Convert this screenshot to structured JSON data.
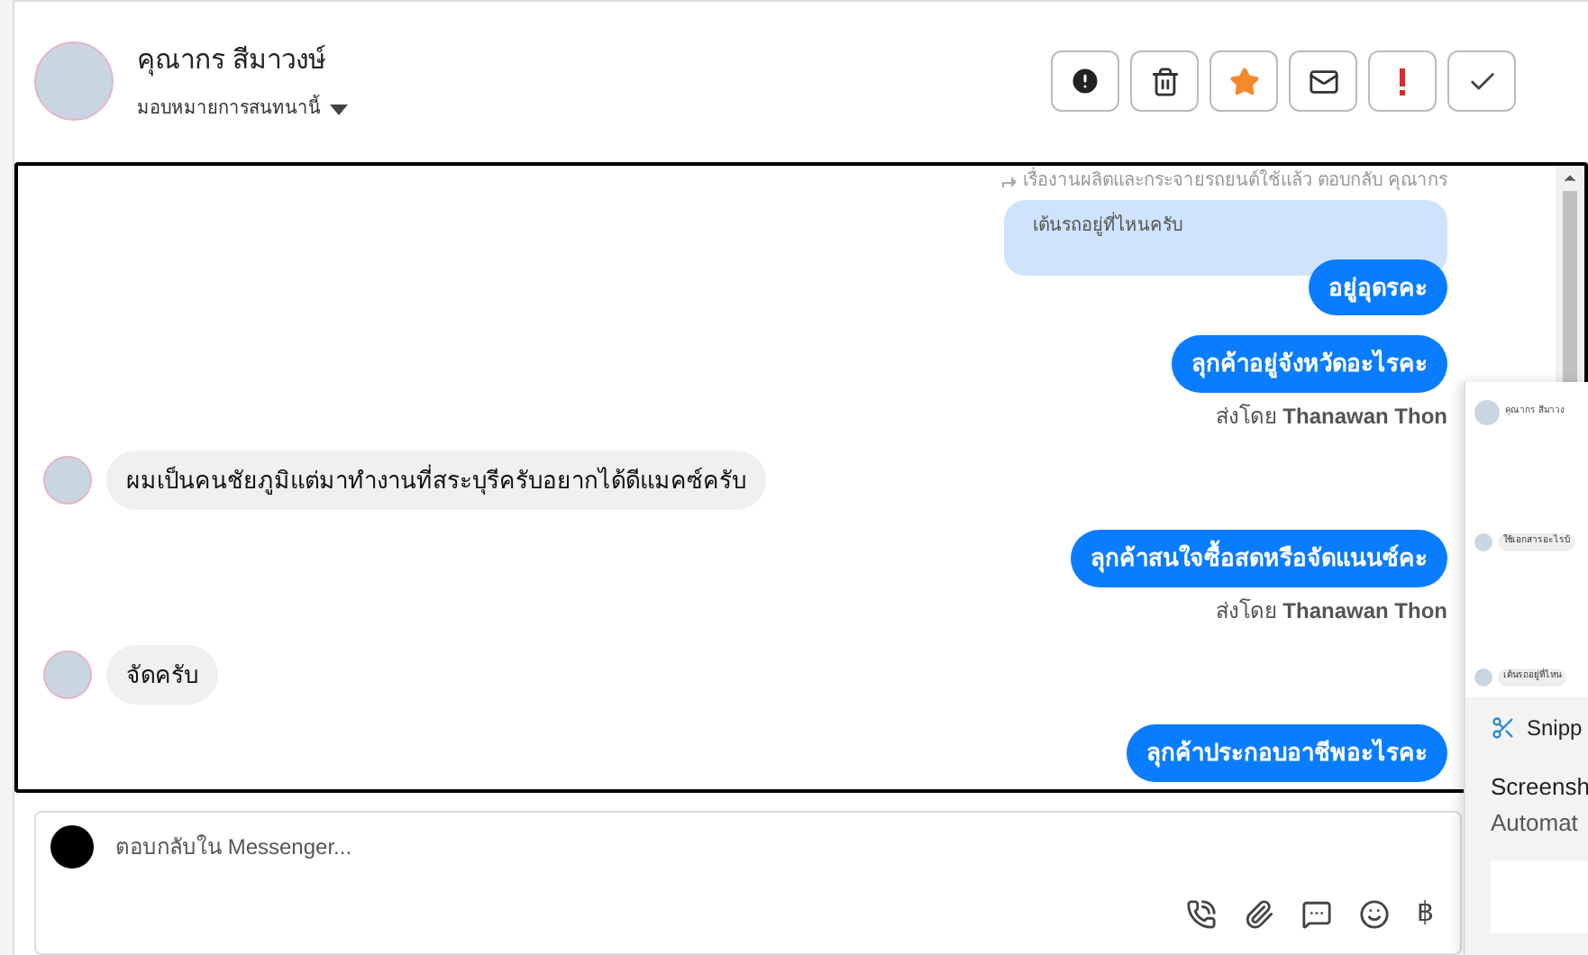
{
  "header": {
    "name": "คุณากร สีมาวงษ์",
    "assign": "มอบหมายการสนทนานี้",
    "actions": [
      {
        "kind": "alert"
      },
      {
        "kind": "trash"
      },
      {
        "kind": "star"
      },
      {
        "kind": "mail"
      },
      {
        "kind": "important"
      },
      {
        "kind": "done"
      }
    ]
  },
  "messages": [
    {
      "kind": "quote",
      "text": "เรื่องานผลิตและกระจายรถยนต์ใช้แล้ว ตอบกลับ คุณากร",
      "quoted": "เต้นรถอยู่ที่ไหนครับ"
    },
    {
      "kind": "outgoing",
      "text": "อยู่อุดรคะ"
    },
    {
      "kind": "outgoing",
      "text": "ลุกค้าอยู่จังหวัดอะไรคะ"
    },
    {
      "kind": "sent_by",
      "text": "ส่งโดย **Thanawan Thon**"
    },
    {
      "kind": "incoming",
      "text": "ผมเป็นคนชัยภูมิแต่มาทำงานที่สระบุรีครับอยากได้ดีแมคซ์ครับ"
    },
    {
      "kind": "outgoing",
      "text": "ลุกค้าสนใจซื้อสดหรือจัดแนนซ์คะ"
    },
    {
      "kind": "sent_by",
      "text": "ส่งโดย **Thanawan Thon**"
    },
    {
      "kind": "incoming",
      "text": "จัดครับ"
    },
    {
      "kind": "outgoing",
      "text": "ลุกค้าประกอบอาชีพอะไรคะ"
    }
  ],
  "reply": {
    "placeholder": "ตอบกลับใน Messenger...",
    "currency": "฿"
  },
  "overlay": {
    "chat_name": "คุณากร สีมาวง",
    "previews": [
      "ใช้เอกสารอะไรบ้",
      "เต้นรถอยู่ที่ไหน"
    ],
    "app": "Snipp",
    "title": "Screensh",
    "subtitle": "Automat"
  }
}
